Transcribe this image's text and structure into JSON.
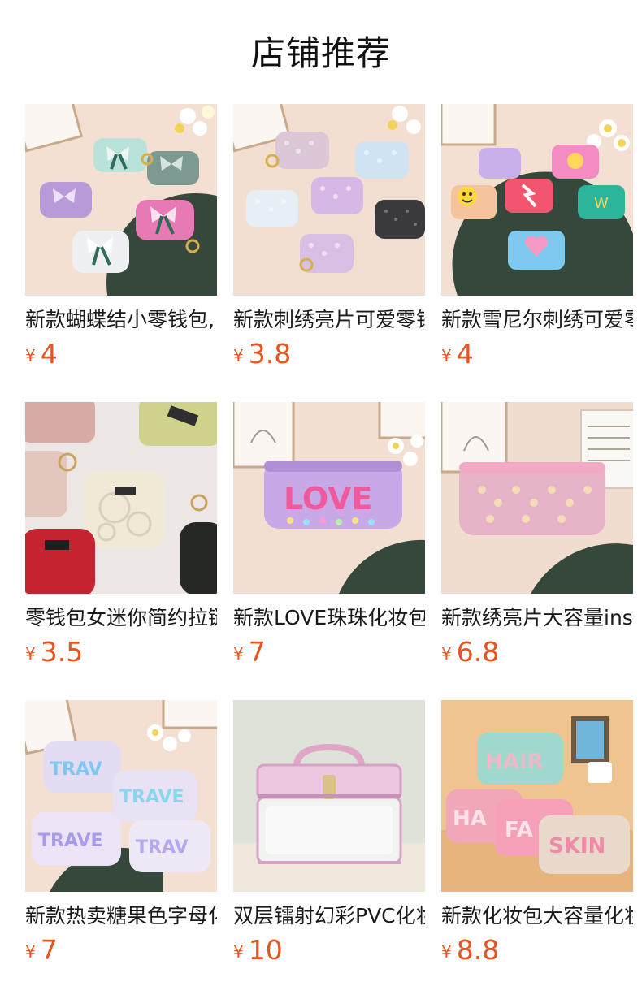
{
  "header": {
    "title": "店铺推荐"
  },
  "colors": {
    "price": "#e8541e",
    "title": "#111111"
  },
  "products": [
    {
      "name": "新款蝴蝶结小零钱包,",
      "currency": "¥",
      "price": "4",
      "image": "butterfly-coin-purses"
    },
    {
      "name": "新款刺绣亮片可爱零钱",
      "currency": "¥",
      "price": "3.8",
      "image": "sequin-coin-purses"
    },
    {
      "name": "新款雪尼尔刺绣可爱零",
      "currency": "¥",
      "price": "4",
      "image": "chenille-patch-purses"
    },
    {
      "name": "零钱包女迷你简约拉链",
      "currency": "¥",
      "price": "3.5",
      "image": "rose-embossed-purses"
    },
    {
      "name": "新款LOVE珠珠化妆包",
      "currency": "¥",
      "price": "7",
      "image": "love-cosmetic-bag"
    },
    {
      "name": "新款绣亮片大容量ins",
      "currency": "¥",
      "price": "6.8",
      "image": "sequin-cosmetic-bag"
    },
    {
      "name": "新款热卖糖果色字母化",
      "currency": "¥",
      "price": "7",
      "image": "travel-letter-bags"
    },
    {
      "name": "双层镭射幻彩PVC化妆",
      "currency": "¥",
      "price": "10",
      "image": "pvc-laser-case"
    },
    {
      "name": "新款化妆包大容量化妆",
      "currency": "¥",
      "price": "8.8",
      "image": "hair-skin-bags"
    }
  ]
}
